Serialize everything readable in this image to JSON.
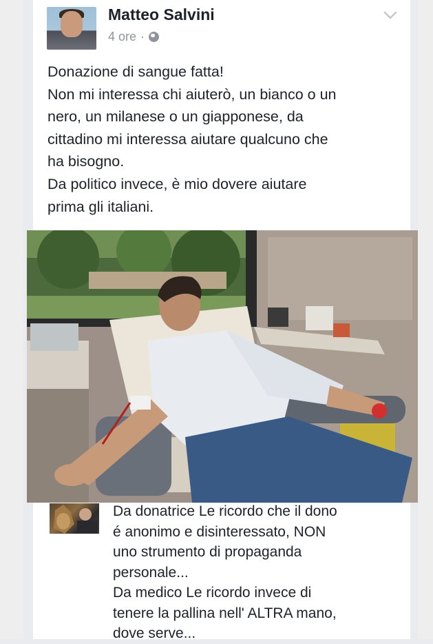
{
  "post": {
    "author": "Matteo Salvini",
    "time": "4 ore",
    "separator": "·",
    "privacy_icon": "globe-icon",
    "menu_icon": "chevron-down-icon",
    "text_lines": [
      "Donazione di sangue fatta!",
      "Non mi interessa chi aiuterò, un bianco o un",
      "nero, un milanese o un giapponese, da",
      "cittadino mi interessa aiutare qualcuno che",
      "ha bisogno.",
      "Da politico invece, è mio dovere aiutare",
      "prima gli italiani."
    ]
  },
  "comment": {
    "text_lines": [
      "Da donatrice Le ricordo che il dono",
      "é anonimo e disinteressato, NON",
      "uno strumento di propaganda",
      "personale...",
      "Da medico Le ricordo invece di",
      "tenere la pallina nell' ALTRA mano,",
      "dove serve..."
    ]
  },
  "colors": {
    "text": "#1d2129",
    "meta": "#90949c",
    "background": "#e9ebee",
    "card": "#ffffff"
  }
}
